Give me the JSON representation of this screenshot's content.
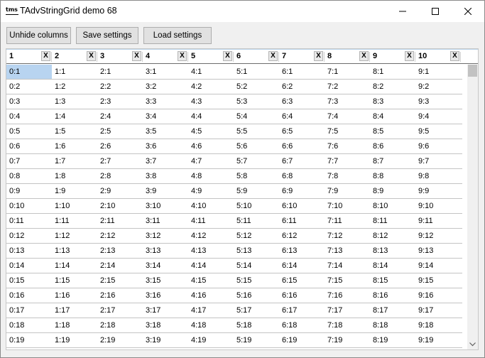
{
  "window": {
    "title": "TAdvStringGrid demo 68",
    "icon_text": "tms"
  },
  "toolbar": {
    "unhide_label": "Unhide columns",
    "save_label": "Save settings",
    "load_label": "Load settings"
  },
  "grid": {
    "close_glyph": "X",
    "columns": [
      "1",
      "2",
      "3",
      "4",
      "5",
      "6",
      "7",
      "8",
      "9",
      "10"
    ],
    "selected_cell": "0:1",
    "rows": [
      [
        "0:1",
        "1:1",
        "2:1",
        "3:1",
        "4:1",
        "5:1",
        "6:1",
        "7:1",
        "8:1",
        "9:1"
      ],
      [
        "0:2",
        "1:2",
        "2:2",
        "3:2",
        "4:2",
        "5:2",
        "6:2",
        "7:2",
        "8:2",
        "9:2"
      ],
      [
        "0:3",
        "1:3",
        "2:3",
        "3:3",
        "4:3",
        "5:3",
        "6:3",
        "7:3",
        "8:3",
        "9:3"
      ],
      [
        "0:4",
        "1:4",
        "2:4",
        "3:4",
        "4:4",
        "5:4",
        "6:4",
        "7:4",
        "8:4",
        "9:4"
      ],
      [
        "0:5",
        "1:5",
        "2:5",
        "3:5",
        "4:5",
        "5:5",
        "6:5",
        "7:5",
        "8:5",
        "9:5"
      ],
      [
        "0:6",
        "1:6",
        "2:6",
        "3:6",
        "4:6",
        "5:6",
        "6:6",
        "7:6",
        "8:6",
        "9:6"
      ],
      [
        "0:7",
        "1:7",
        "2:7",
        "3:7",
        "4:7",
        "5:7",
        "6:7",
        "7:7",
        "8:7",
        "9:7"
      ],
      [
        "0:8",
        "1:8",
        "2:8",
        "3:8",
        "4:8",
        "5:8",
        "6:8",
        "7:8",
        "8:8",
        "9:8"
      ],
      [
        "0:9",
        "1:9",
        "2:9",
        "3:9",
        "4:9",
        "5:9",
        "6:9",
        "7:9",
        "8:9",
        "9:9"
      ],
      [
        "0:10",
        "1:10",
        "2:10",
        "3:10",
        "4:10",
        "5:10",
        "6:10",
        "7:10",
        "8:10",
        "9:10"
      ],
      [
        "0:11",
        "1:11",
        "2:11",
        "3:11",
        "4:11",
        "5:11",
        "6:11",
        "7:11",
        "8:11",
        "9:11"
      ],
      [
        "0:12",
        "1:12",
        "2:12",
        "3:12",
        "4:12",
        "5:12",
        "6:12",
        "7:12",
        "8:12",
        "9:12"
      ],
      [
        "0:13",
        "1:13",
        "2:13",
        "3:13",
        "4:13",
        "5:13",
        "6:13",
        "7:13",
        "8:13",
        "9:13"
      ],
      [
        "0:14",
        "1:14",
        "2:14",
        "3:14",
        "4:14",
        "5:14",
        "6:14",
        "7:14",
        "8:14",
        "9:14"
      ],
      [
        "0:15",
        "1:15",
        "2:15",
        "3:15",
        "4:15",
        "5:15",
        "6:15",
        "7:15",
        "8:15",
        "9:15"
      ],
      [
        "0:16",
        "1:16",
        "2:16",
        "3:16",
        "4:16",
        "5:16",
        "6:16",
        "7:16",
        "8:16",
        "9:16"
      ],
      [
        "0:17",
        "1:17",
        "2:17",
        "3:17",
        "4:17",
        "5:17",
        "6:17",
        "7:17",
        "8:17",
        "9:17"
      ],
      [
        "0:18",
        "1:18",
        "2:18",
        "3:18",
        "4:18",
        "5:18",
        "6:18",
        "7:18",
        "8:18",
        "9:18"
      ],
      [
        "0:19",
        "1:19",
        "2:19",
        "3:19",
        "4:19",
        "5:19",
        "6:19",
        "7:19",
        "8:19",
        "9:19"
      ]
    ]
  },
  "colors": {
    "selection": "#b8d4f0",
    "grid_line": "#c4c4c4",
    "button_face": "#e1e1e1"
  }
}
